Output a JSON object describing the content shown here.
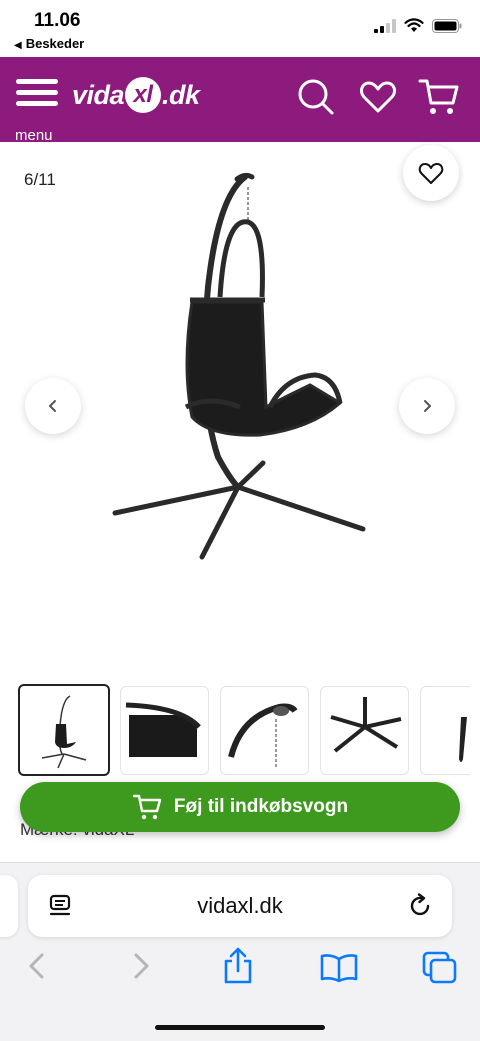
{
  "status_bar": {
    "time": "11.06",
    "back_label": "Beskeder"
  },
  "header": {
    "menu_label": "menu",
    "logo_left": "vida",
    "logo_mark": "xl",
    "logo_right": ".dk",
    "icons": [
      "search-icon",
      "heart-icon",
      "cart-icon"
    ],
    "brand_color": "#8d1b7d"
  },
  "gallery": {
    "counter": "6/11",
    "thumbnail_count_visible": 5
  },
  "product": {
    "brand_line": "Mærke: vidaXL",
    "add_to_cart_label": "Føj til indkøbsvogn",
    "button_color": "#3d9a1f"
  },
  "browser": {
    "url": "vidaxl.dk",
    "toolbar_icons": [
      "back-icon",
      "forward-icon",
      "share-icon",
      "bookmarks-icon",
      "tabs-icon"
    ]
  }
}
